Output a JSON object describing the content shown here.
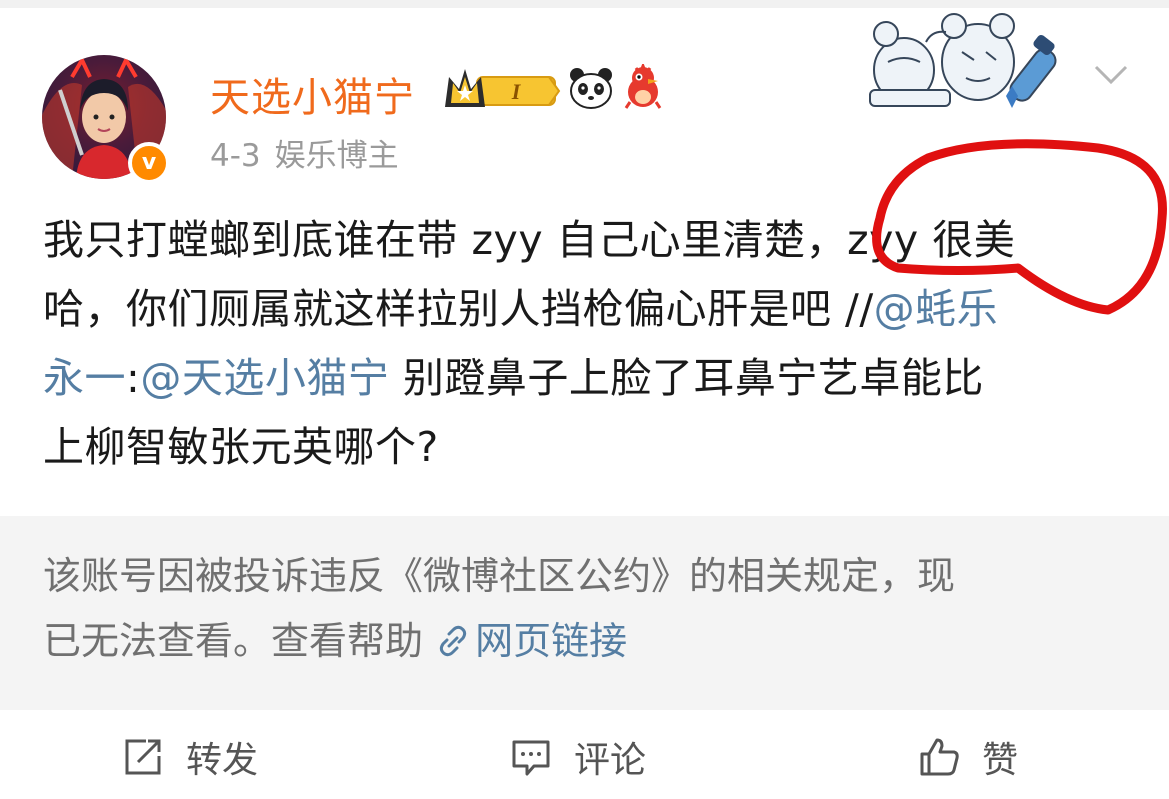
{
  "post": {
    "username": "天选小猫宁",
    "vip_level": "I",
    "date": "4-3",
    "user_tag": "娱乐博主",
    "content_lines": [
      "我只打螳螂到底谁在带 zyy 自己心里清楚，zyy 很美",
      "哈，你们厕属就这样拉别人挡枪偏心肝是吧 //"
    ],
    "repost_mention": "@蚝乐",
    "repost_mention_cont": "永一",
    "repost_colon": ":",
    "reply_mention": "@天选小猫宁",
    "reply_text_1": " 别蹬鼻子上脸了耳鼻宁艺卓能比",
    "reply_text_2": "上柳智敏张元英哪个?"
  },
  "notice": {
    "line1": "该账号因被投诉违反《微博社区公约》的相关规定，现",
    "line2": "已无法查看。查看帮助 ",
    "link_label": "网页链接"
  },
  "actions": {
    "repost_label": "转发",
    "comment_label": "评论",
    "like_label": "赞"
  },
  "colors": {
    "username": "#f06a1c",
    "mention": "#557ea3",
    "annotation": "#e01010"
  },
  "icons": [
    "verified-badge-icon",
    "vip-crown-icon",
    "panda-icon",
    "bird-icon",
    "chevron-down-icon",
    "link-icon",
    "repost-icon",
    "comment-icon",
    "like-icon"
  ]
}
